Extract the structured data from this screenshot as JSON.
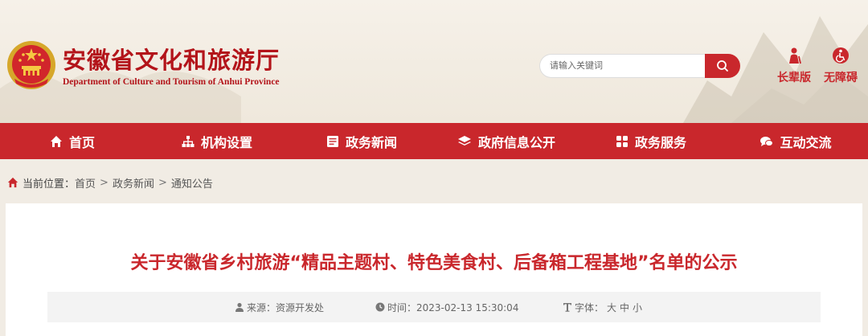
{
  "site": {
    "title_cn": "安徽省文化和旅游厅",
    "title_en": "Department of Culture and Tourism of Anhui Province",
    "brand_color": "#c9272c"
  },
  "search": {
    "placeholder": "请输入关键词",
    "icon": "search-icon"
  },
  "tools": {
    "elder": "长辈版",
    "accessible": "无障碍"
  },
  "nav": [
    {
      "label": "首页",
      "icon": "home-icon"
    },
    {
      "label": "机构设置",
      "icon": "sitemap-icon"
    },
    {
      "label": "政务新闻",
      "icon": "newspaper-icon"
    },
    {
      "label": "政府信息公开",
      "icon": "layers-icon"
    },
    {
      "label": "政务服务",
      "icon": "grid-icon"
    },
    {
      "label": "互动交流",
      "icon": "chat-icon"
    }
  ],
  "breadcrumb": {
    "prefix": "当前位置：",
    "items": [
      "首页",
      "政务新闻",
      "通知公告"
    ],
    "separator": ">"
  },
  "article": {
    "title": "关于安徽省乡村旅游“精品主题村、特色美食村、后备箱工程基地”名单的公示",
    "source": "来源：资源开发处",
    "time": "时间：2023-02-13 15:30:04",
    "font_label": "字体：",
    "font_sizes": [
      "大",
      "中",
      "小"
    ]
  }
}
